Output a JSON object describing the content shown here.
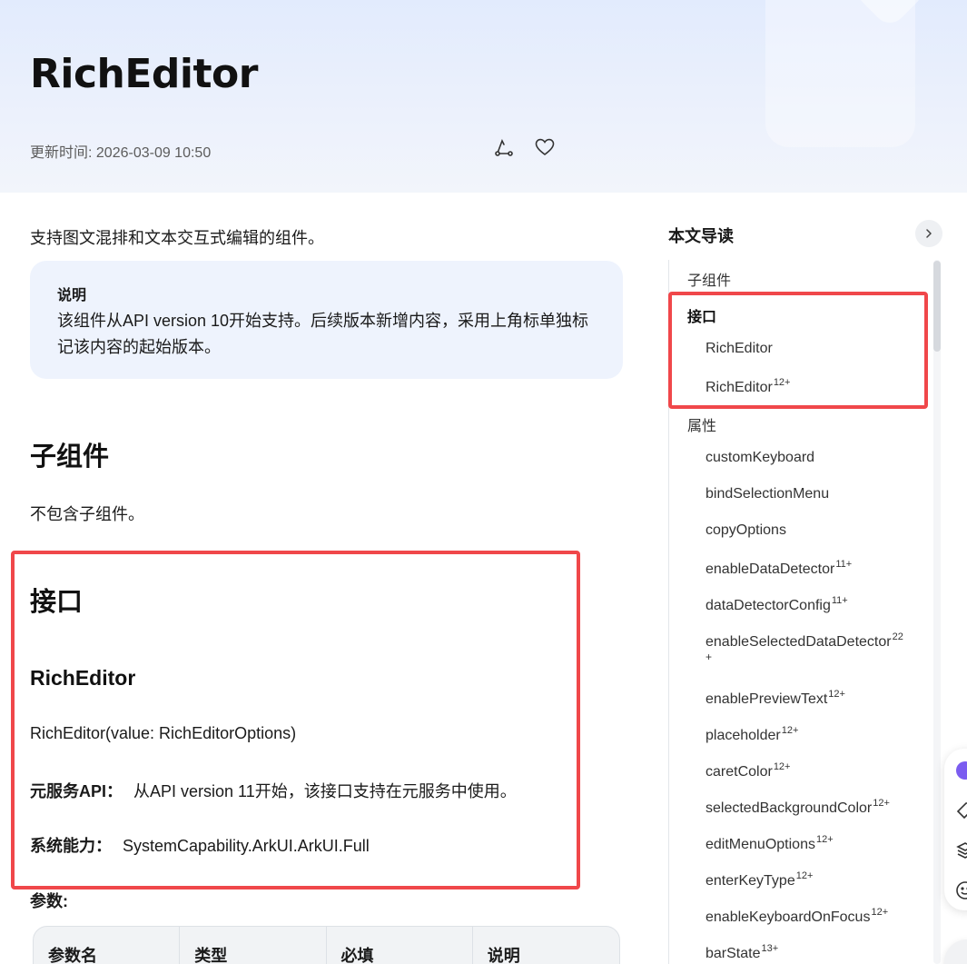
{
  "header": {
    "title": "RichEditor",
    "update_time": "更新时间: 2026-03-09 10:50",
    "share_icon": "share-icon",
    "favorite_icon": "heart-icon"
  },
  "content": {
    "intro": "支持图文混排和文本交互式编辑的组件。",
    "note": {
      "title": "说明",
      "body": "该组件从API version 10开始支持。后续版本新增内容，采用上角标单独标记该内容的起始版本。"
    },
    "section_children": {
      "heading": "子组件",
      "text": "不包含子组件。"
    },
    "section_interface": {
      "heading": "接口",
      "sub_heading": "RichEditor",
      "signature": "RichEditor(value: RichEditorOptions)",
      "atomic_label": "元服务API：",
      "atomic_text": "从API version 11开始，该接口支持在元服务中使用。",
      "syscap_label": "系统能力：",
      "syscap_text": "SystemCapability.ArkUI.ArkUI.Full",
      "params_label": "参数:"
    },
    "table_headers": [
      "参数名",
      "类型",
      "必填",
      "说明"
    ]
  },
  "toc": {
    "title": "本文导读",
    "items": [
      {
        "label": "子组件",
        "sup": ""
      },
      {
        "label": "接口",
        "sup": ""
      },
      {
        "label": "RichEditor",
        "sup": ""
      },
      {
        "label": "RichEditor",
        "sup": "12+"
      },
      {
        "label": "属性",
        "sup": ""
      },
      {
        "label": "customKeyboard",
        "sup": ""
      },
      {
        "label": "bindSelectionMenu",
        "sup": ""
      },
      {
        "label": "copyOptions",
        "sup": ""
      },
      {
        "label": "enableDataDetector",
        "sup": "11+"
      },
      {
        "label": "dataDetectorConfig",
        "sup": "11+"
      },
      {
        "label": "enableSelectedDataDetector",
        "sup": "22"
      },
      {
        "label": "enablePreviewText",
        "sup": "12+"
      },
      {
        "label": "placeholder",
        "sup": "12+"
      },
      {
        "label": "caretColor",
        "sup": "12+"
      },
      {
        "label": "selectedBackgroundColor",
        "sup": "12+"
      },
      {
        "label": "editMenuOptions",
        "sup": "12+"
      },
      {
        "label": "enterKeyType",
        "sup": "12+"
      },
      {
        "label": "enableKeyboardOnFocus",
        "sup": "12+"
      },
      {
        "label": "barState",
        "sup": "13+"
      }
    ],
    "wrap_plus": "+"
  },
  "colors": {
    "highlight_box": "#f0474a",
    "note_bg": "#eef3fd"
  }
}
